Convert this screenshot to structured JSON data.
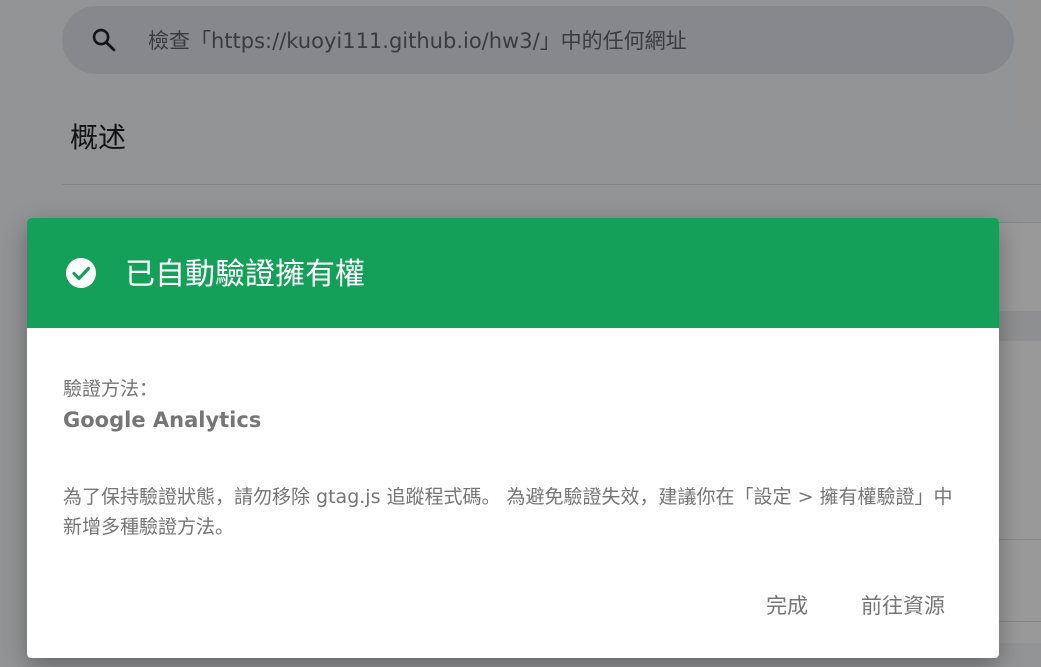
{
  "search": {
    "placeholder": "檢查「https://kuoyi111.github.io/hw3/」中的任何網址"
  },
  "page": {
    "title": "概述"
  },
  "dialog": {
    "title": "已自動驗證擁有權",
    "method_label": "驗證方法：",
    "method_value": "Google Analytics",
    "body": "為了保持驗證狀態，請勿移除 gtag.js 追蹤程式碼。 為避免驗證失效，建議你在「設定 > 擁有權驗證」中新增多種驗證方法。",
    "done_button": "完成",
    "goto_button": "前往資源"
  },
  "colors": {
    "header_green": "#15a05a",
    "muted_text": "#757575"
  },
  "icons": {
    "search": "search-icon",
    "check": "check-circle-icon"
  }
}
